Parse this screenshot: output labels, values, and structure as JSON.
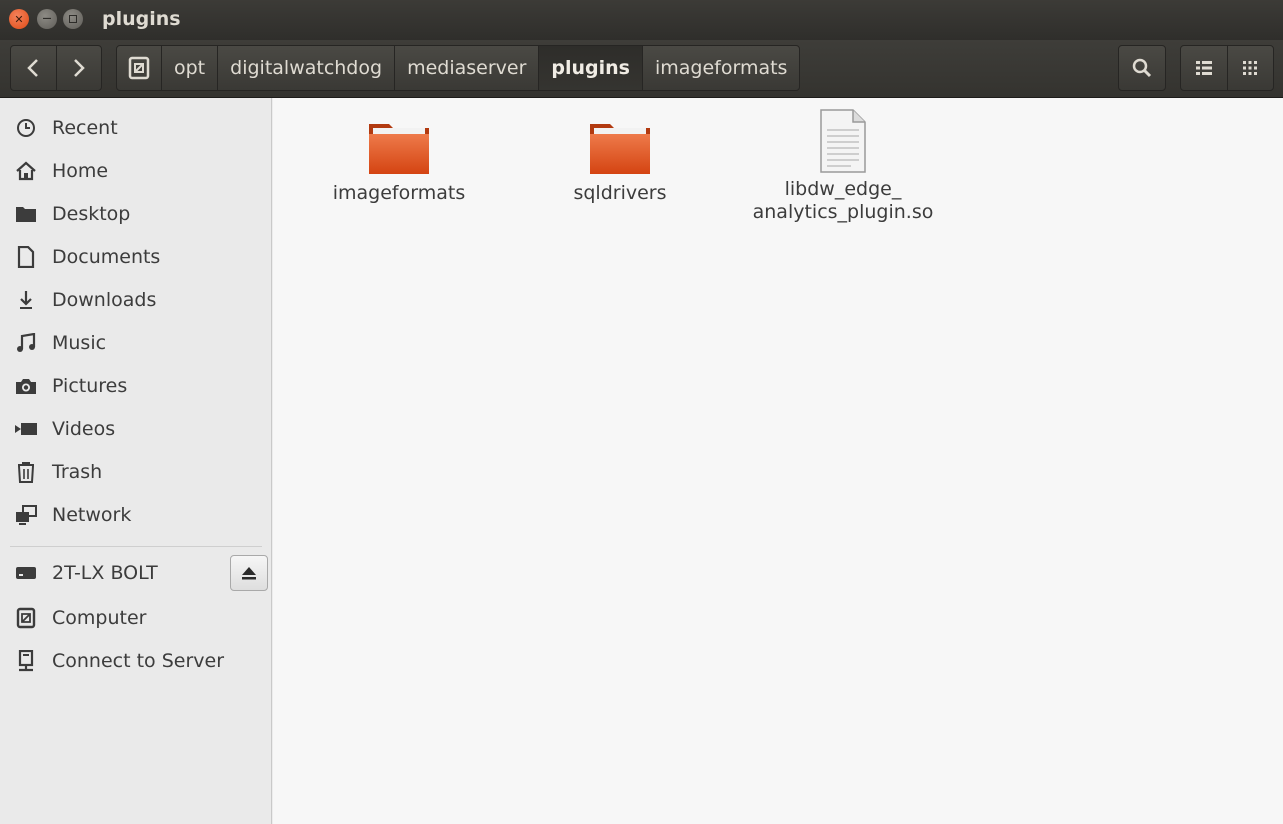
{
  "window": {
    "title": "plugins"
  },
  "breadcrumbs": [
    {
      "label": "opt"
    },
    {
      "label": "digitalwatchdog"
    },
    {
      "label": "mediaserver"
    },
    {
      "label": "plugins"
    },
    {
      "label": "imageformats"
    }
  ],
  "sidebar": {
    "places": [
      {
        "label": "Recent",
        "icon": "clock-icon"
      },
      {
        "label": "Home",
        "icon": "home-icon"
      },
      {
        "label": "Desktop",
        "icon": "folder-icon"
      },
      {
        "label": "Documents",
        "icon": "document-icon"
      },
      {
        "label": "Downloads",
        "icon": "download-icon"
      },
      {
        "label": "Music",
        "icon": "music-icon"
      },
      {
        "label": "Pictures",
        "icon": "camera-icon"
      },
      {
        "label": "Videos",
        "icon": "video-icon"
      },
      {
        "label": "Trash",
        "icon": "trash-icon"
      },
      {
        "label": "Network",
        "icon": "network-icon"
      }
    ],
    "devices": [
      {
        "label": "2T-LX BOLT",
        "icon": "drive-icon"
      },
      {
        "label": "Computer",
        "icon": "computer-icon"
      },
      {
        "label": "Connect to Server",
        "icon": "server-icon"
      }
    ]
  },
  "files": [
    {
      "name": "imageformats",
      "type": "folder"
    },
    {
      "name": "sqldrivers",
      "type": "folder"
    },
    {
      "name_line1": "libdw_edge_",
      "name_line2": "analytics_plugin.so",
      "type": "file"
    }
  ],
  "colors": {
    "folder": "#e0521f",
    "accent": "#df4b16"
  }
}
